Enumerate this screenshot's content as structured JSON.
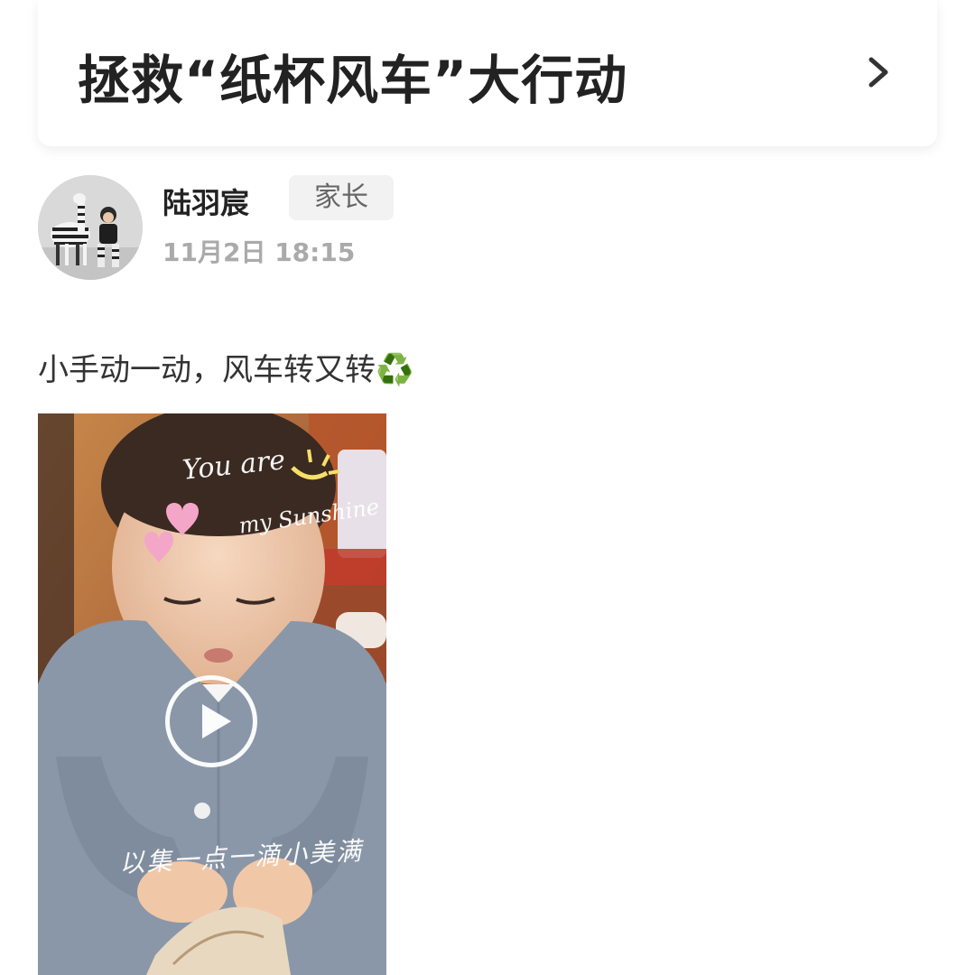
{
  "title_card": {
    "title": "拯救“纸杯风车”大行动",
    "chevron_icon": "chevron-right-icon"
  },
  "author": {
    "name": "陆羽宸",
    "role": "家长",
    "time": "11月2日 18:15"
  },
  "post": {
    "text": "小手动一动，风车转又转",
    "emoji": "♻️"
  },
  "video": {
    "play_icon": "play-icon",
    "overlay_line1": "You are",
    "overlay_line2": "my Sunshine",
    "overlay_caption": "以集一点一滴小美满"
  },
  "colors": {
    "title_text": "#222222",
    "secondary_text": "#aaaaaa",
    "badge_bg": "#f2f2f2"
  }
}
